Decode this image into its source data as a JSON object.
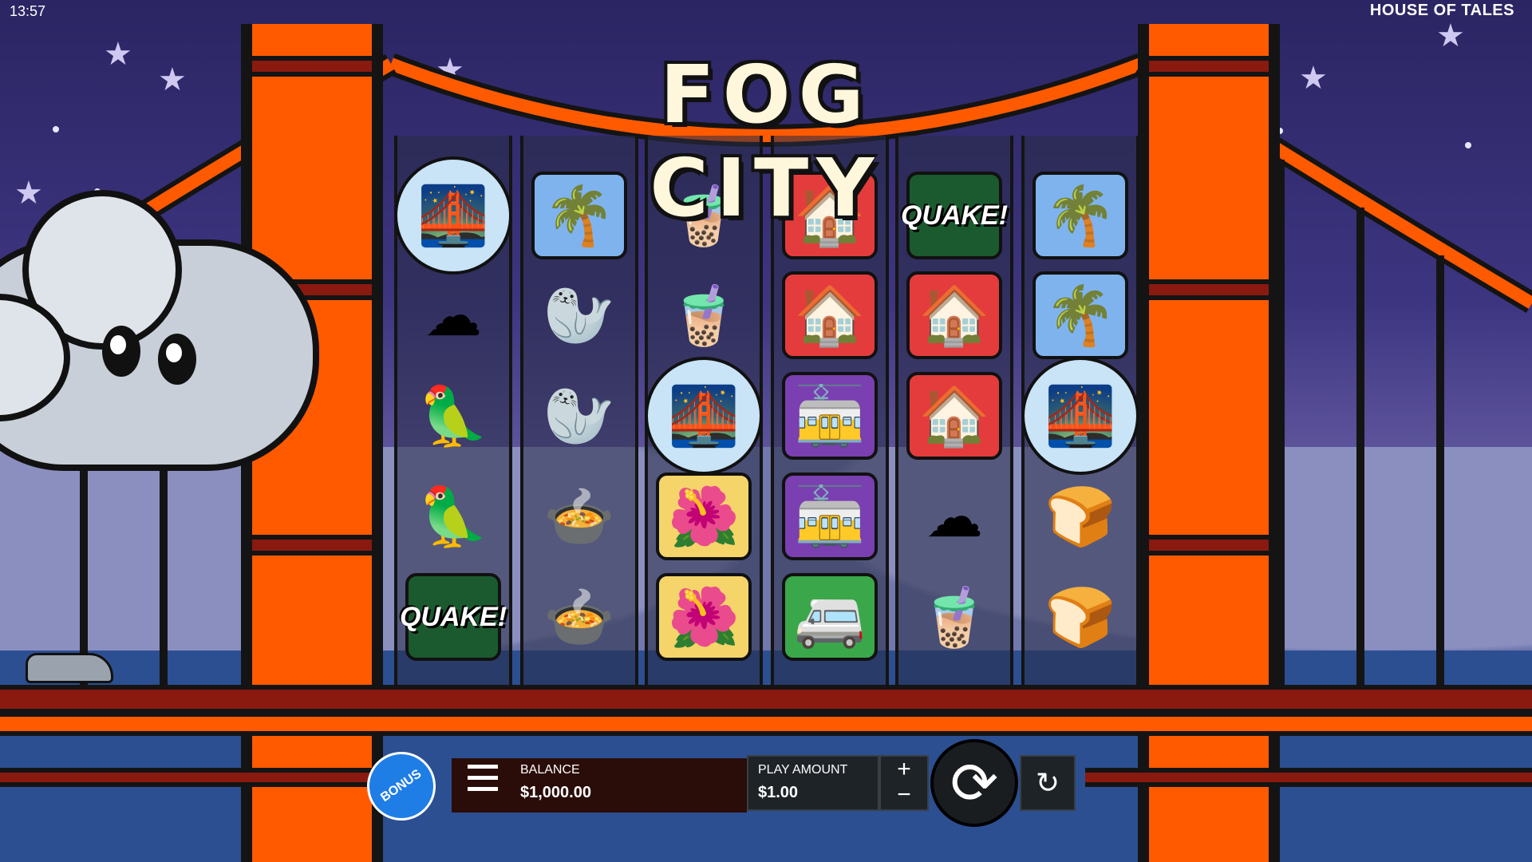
{
  "status_bar": {
    "time": "13:57",
    "brand": "HOUSE OF TALES"
  },
  "game": {
    "title": "FOG CITY"
  },
  "reels": [
    [
      "bridge",
      "cloud",
      "parrot",
      "parrot",
      "quake"
    ],
    [
      "palm",
      "seal",
      "seal",
      "soup",
      "soup"
    ],
    [
      "boba",
      "boba",
      "bridge",
      "flowers",
      "flowers"
    ],
    [
      "house",
      "house",
      "trolley",
      "trolley",
      "van"
    ],
    [
      "quake",
      "house",
      "house",
      "yellow-cloud",
      "boba"
    ],
    [
      "palm",
      "palm",
      "bridge",
      "bread",
      "bread"
    ]
  ],
  "symbols": {
    "bridge": {
      "glyph": "🌉",
      "bg": "#c9e3f7"
    },
    "cloud": {
      "glyph": "☁",
      "bg": "transparent"
    },
    "parrot": {
      "glyph": "🦜",
      "bg": "transparent"
    },
    "quake": {
      "text": "QUAKE!",
      "bg": "#1b5a2f"
    },
    "palm": {
      "glyph": "🌴",
      "bg": "#7fb3ee"
    },
    "seal": {
      "glyph": "🦭",
      "bg": "transparent"
    },
    "soup": {
      "glyph": "🍲",
      "bg": "transparent"
    },
    "boba": {
      "glyph": "🧋",
      "bg": "transparent"
    },
    "flowers": {
      "glyph": "🌺",
      "bg": "#f5d46a"
    },
    "house": {
      "glyph": "🏠",
      "bg": "#e43c3c"
    },
    "trolley": {
      "glyph": "🚋",
      "bg": "#7a3fb0"
    },
    "van": {
      "glyph": "🚐",
      "bg": "#3aa84a"
    },
    "yellow-cloud": {
      "glyph": "☁",
      "bg": "transparent"
    },
    "bread": {
      "glyph": "🍞",
      "bg": "transparent"
    }
  },
  "controls": {
    "bonus_label": "BONUS",
    "balance_label": "BALANCE",
    "balance_value": "$1,000.00",
    "play_amount_label": "PLAY AMOUNT",
    "play_amount_value": "$1.00",
    "plus": "+",
    "minus": "−",
    "spin_icon": "⟳",
    "autoplay_icon": "↻"
  },
  "colors": {
    "bridge_orange": "#ff5a00",
    "bridge_dark": "#8a1a10",
    "sky": "#3d3580",
    "bonus_blue": "#1f7de6"
  }
}
